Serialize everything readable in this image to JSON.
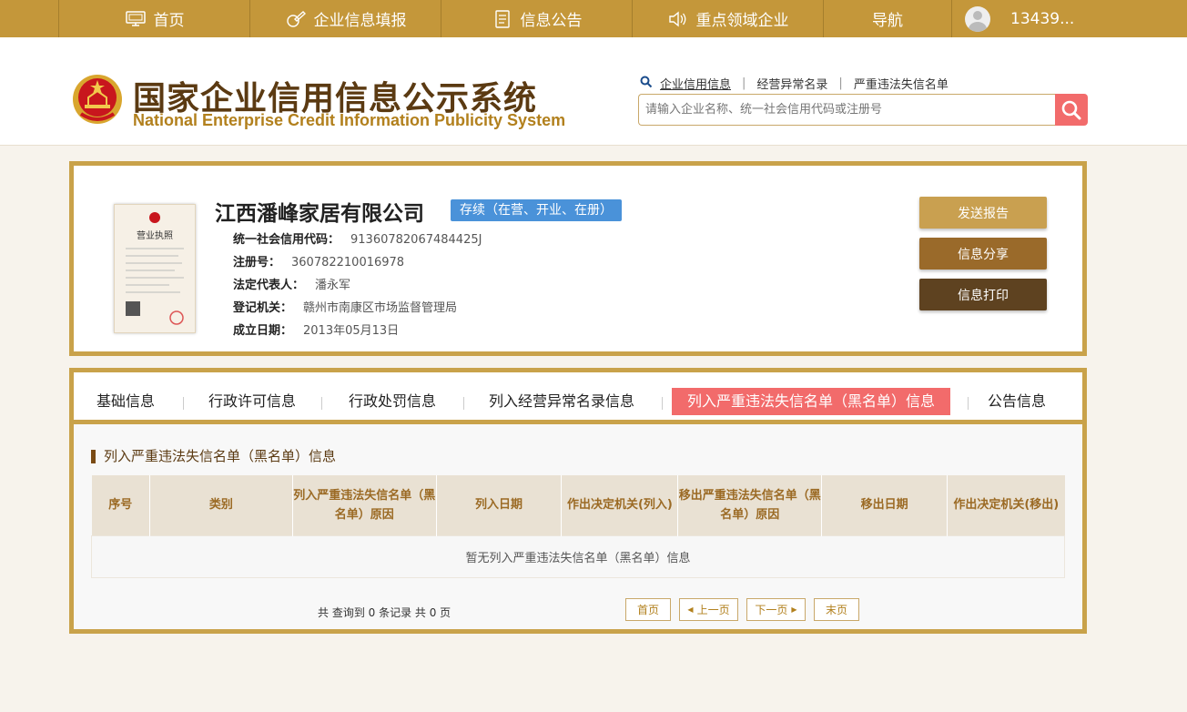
{
  "topnav": {
    "items": [
      {
        "label": "首页",
        "icon": "monitor-icon"
      },
      {
        "label": "企业信息填报",
        "icon": "edit-icon"
      },
      {
        "label": "信息公告",
        "icon": "document-icon"
      },
      {
        "label": "重点领域企业",
        "icon": "speaker-icon"
      },
      {
        "label": "导航",
        "icon": ""
      }
    ],
    "user": "13439..."
  },
  "header": {
    "title": "国家企业信用信息公示系统",
    "subtitle": "National Enterprise Credit Information Publicity System",
    "search_links": [
      "企业信用信息",
      "经营异常名录",
      "严重违法失信名单"
    ],
    "search_placeholder": "请输入企业名称、统一社会信用代码或注册号"
  },
  "company": {
    "name": "江西潘峰家居有限公司",
    "status": "存续（在营、开业、在册）",
    "fields": [
      {
        "label": "统一社会信用代码：",
        "value": "91360782067484425J"
      },
      {
        "label": "注册号：",
        "value": "360782210016978"
      },
      {
        "label": "法定代表人：",
        "value": "潘永军"
      },
      {
        "label": "登记机关：",
        "value": "赣州市南康区市场监督管理局"
      },
      {
        "label": "成立日期：",
        "value": "2013年05月13日"
      }
    ],
    "license_title": "营业执照",
    "actions": [
      "发送报告",
      "信息分享",
      "信息打印"
    ]
  },
  "tabs": [
    "基础信息",
    "行政许可信息",
    "行政处罚信息",
    "列入经营异常名录信息",
    "列入严重违法失信名单（黑名单）信息",
    "公告信息"
  ],
  "active_tab": 4,
  "section": {
    "title": "列入严重违法失信名单（黑名单）信息",
    "columns": [
      "序号",
      "类别",
      "列入严重违法失信名单（黑名单）原因",
      "列入日期",
      "作出决定机关(列入)",
      "移出严重违法失信名单（黑名单）原因",
      "移出日期",
      "作出决定机关(移出)"
    ],
    "empty_text": "暂无列入严重违法失信名单（黑名单）信息"
  },
  "pager": {
    "info": "共 查询到 0 条记录 共 0 页",
    "first": "首页",
    "prev": "上一页",
    "next": "下一页",
    "last": "末页"
  },
  "colors": {
    "gold": "#c4973a",
    "active_tab": "#f26b6b",
    "status": "#4a92d9",
    "btn_report": "#c9a050",
    "btn_share": "#9a6a2a",
    "btn_print": "#5e4220"
  }
}
